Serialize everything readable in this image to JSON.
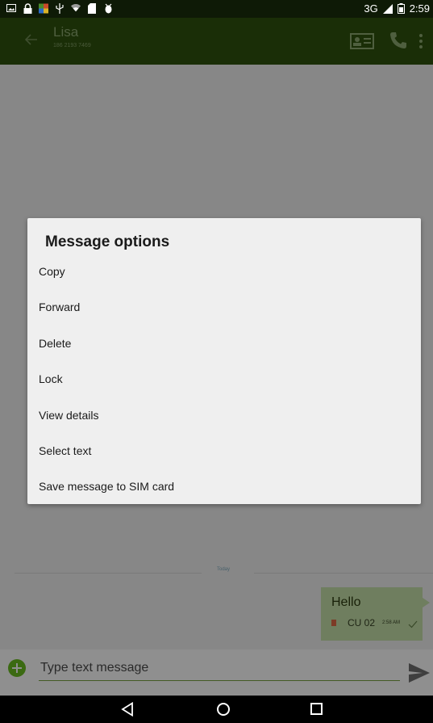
{
  "status_bar": {
    "icons_left": [
      "image-icon",
      "lock-icon",
      "app-icon",
      "usb-icon",
      "wifi-icon",
      "sd-card-icon",
      "debug-icon"
    ],
    "network": "3G",
    "time": "2:59"
  },
  "toolbar": {
    "contact_name": "Lisa",
    "contact_number": "186 2193 7469"
  },
  "conversation": {
    "date_divider": "Today",
    "message": {
      "text": "Hello",
      "carrier": "CU 02",
      "time": "2:58 AM",
      "status_icon": "sent-check-icon"
    }
  },
  "compose": {
    "placeholder": "Type text message"
  },
  "dialog": {
    "title": "Message options",
    "options": [
      "Copy",
      "Forward",
      "Delete",
      "Lock",
      "View details",
      "Select text",
      "Save message to SIM card"
    ]
  },
  "colors": {
    "toolbar_dimmed": "#1a2e07",
    "conversation_dimmed": "#878787",
    "bubble_dimmed": "#6f7e5f",
    "dialog_bg": "#efefef"
  }
}
